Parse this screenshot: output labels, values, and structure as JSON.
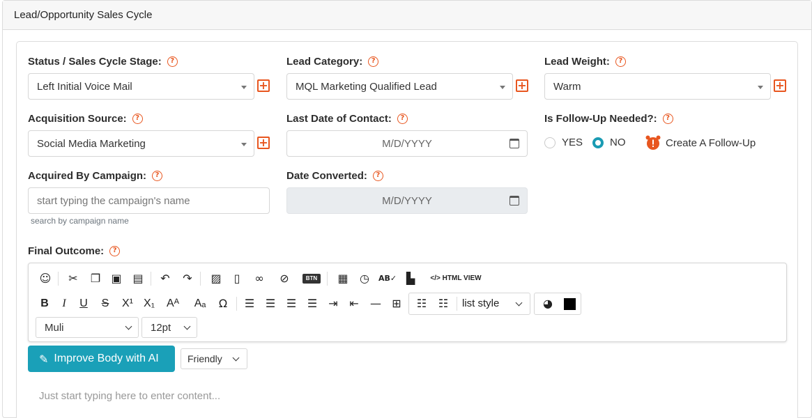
{
  "panel": {
    "title": "Lead/Opportunity Sales Cycle"
  },
  "fields": {
    "status": {
      "label": "Status / Sales Cycle Stage:",
      "value": "Left Initial Voice Mail"
    },
    "lead_category": {
      "label": "Lead Category:",
      "value": "MQL Marketing Qualified Lead"
    },
    "lead_weight": {
      "label": "Lead Weight:",
      "value": "Warm"
    },
    "acquisition_source": {
      "label": "Acquisition Source:",
      "value": "Social Media Marketing"
    },
    "last_contact": {
      "label": "Last Date of Contact:",
      "placeholder": "M/D/YYYY"
    },
    "follow_up": {
      "label": "Is Follow-Up Needed?:",
      "yes": "YES",
      "no": "NO",
      "selected": "NO",
      "create_label": "Create A Follow-Up"
    },
    "campaign": {
      "label": "Acquired By Campaign:",
      "placeholder": "start typing the campaign's name",
      "hint": "search by campaign name"
    },
    "date_converted": {
      "label": "Date Converted:",
      "placeholder": "M/D/YYYY"
    },
    "final_outcome": {
      "label": "Final Outcome:"
    }
  },
  "editor": {
    "html_view": "HTML VIEW",
    "btn_badge": "BTN",
    "list_style": "list style",
    "font": "Muli",
    "size": "12pt",
    "text_color": "#000000",
    "placeholder": "Just start typing here to enter content..."
  },
  "ai": {
    "button": "Improve Body with AI",
    "tone": "Friendly"
  },
  "colors": {
    "accent": "#1aa0b8",
    "help": "#e8561f"
  }
}
